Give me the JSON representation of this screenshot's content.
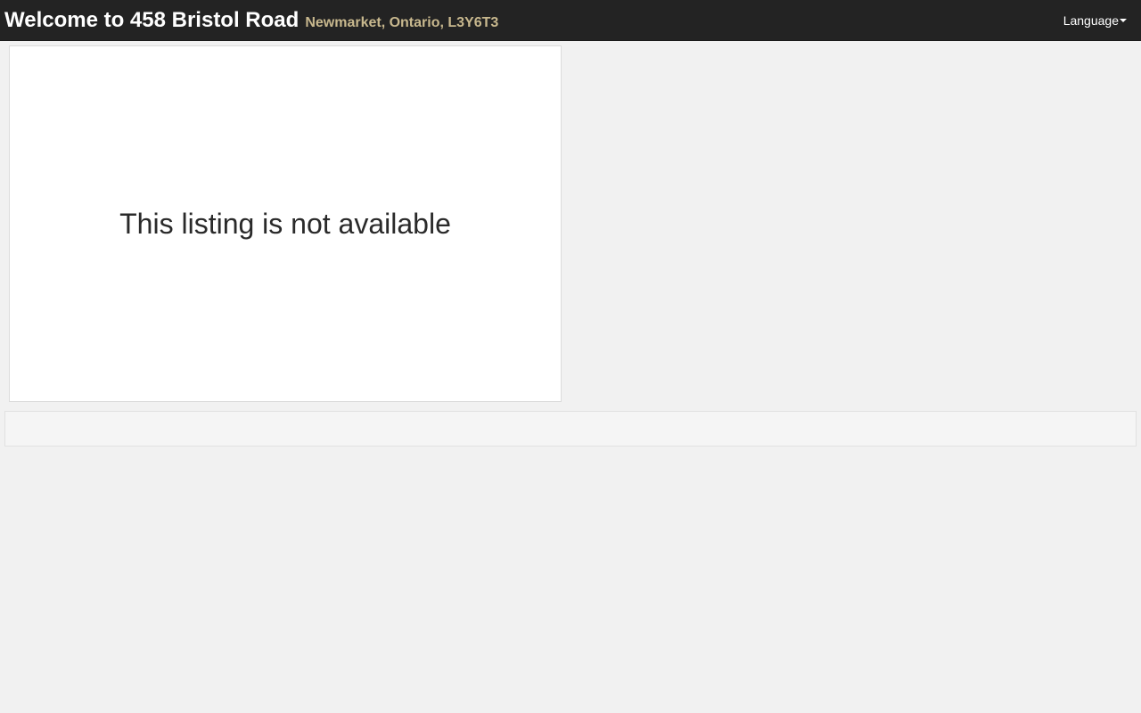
{
  "header": {
    "title": "Welcome to 458 Bristol Road",
    "subtitle": "Newmarket, Ontario, L3Y6T3",
    "language_label": "Language"
  },
  "main": {
    "notice": "This listing is not available"
  },
  "colors": {
    "header_bg": "#232323",
    "subtitle": "#c8b88e",
    "page_bg": "#f1f1f1"
  }
}
